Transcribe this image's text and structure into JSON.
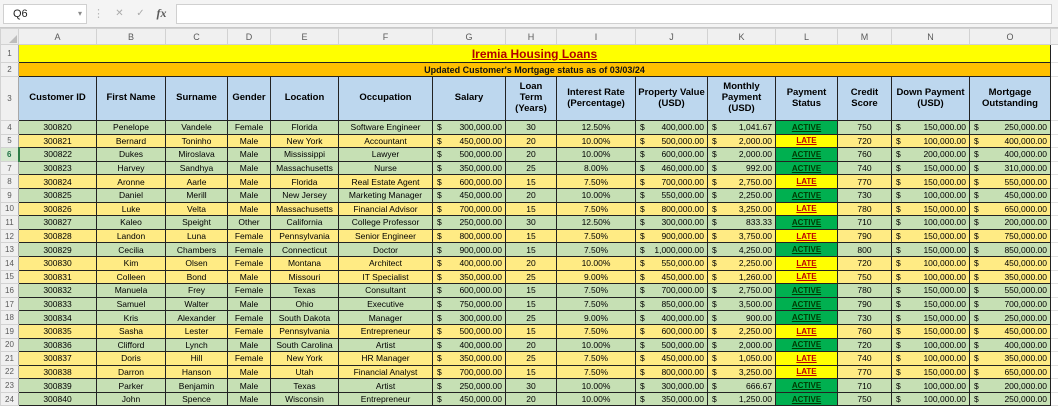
{
  "formula_bar": {
    "name_box_value": "Q6",
    "cancel_label": "✕",
    "confirm_label": "✓",
    "insert_function_label": "fx",
    "formula_value": ""
  },
  "sheet": {
    "column_letters": [
      "A",
      "B",
      "C",
      "D",
      "E",
      "F",
      "G",
      "H",
      "I",
      "J",
      "K",
      "L",
      "M",
      "N",
      "O"
    ],
    "row_numbers": [
      "1",
      "2",
      "3",
      "4",
      "5",
      "6",
      "7",
      "8",
      "9",
      "10",
      "11",
      "12",
      "13",
      "14",
      "15",
      "16",
      "17",
      "18",
      "19",
      "20",
      "21",
      "22",
      "23",
      "24"
    ],
    "first_data_row": 4,
    "active_row": 6,
    "title": "Iremia Housing Loans",
    "subtitle": "Updated Customer's Mortgage status as of 03/03/24"
  },
  "colors": {
    "title_bg": "#ffff00",
    "title_text": "#b30000",
    "subtitle_bg": "#ffc000",
    "header_bg": "#bdd7ee",
    "active_row_bg": "#c6e0b4",
    "late_row_bg": "#ffeb84",
    "status_active_bg": "#00b050",
    "status_late_bg": "#ffff00",
    "status_late_text": "#c00000"
  },
  "table": {
    "currency_symbol": "$",
    "headers": [
      "Customer ID",
      "First Name",
      "Surname",
      "Gender",
      "Location",
      "Occupation",
      "Salary",
      "Loan Term (Years)",
      "Interest Rate (Percentage)",
      "Property Value (USD)",
      "Monthly Payment (USD)",
      "Payment Status",
      "Credit Score",
      "Down Payment (USD)",
      "Mortgage Outstanding"
    ],
    "rows": [
      {
        "customer_id": "300820",
        "first_name": "Penelope",
        "surname": "Vandele",
        "gender": "Female",
        "location": "Florida",
        "occupation": "Software Engineer",
        "salary": "300,000.00",
        "loan_term": "30",
        "interest_rate": "12.50%",
        "property_value": "400,000.00",
        "monthly_payment": "1,041.67",
        "payment_status": "ACTIVE",
        "credit_score": "750",
        "down_payment": "150,000.00",
        "mortgage_outstanding": "250,000.00"
      },
      {
        "customer_id": "300821",
        "first_name": "Bernard",
        "surname": "Toninho",
        "gender": "Male",
        "location": "New York",
        "occupation": "Accountant",
        "salary": "450,000.00",
        "loan_term": "20",
        "interest_rate": "10.00%",
        "property_value": "500,000.00",
        "monthly_payment": "2,000.00",
        "payment_status": "LATE",
        "credit_score": "720",
        "down_payment": "100,000.00",
        "mortgage_outstanding": "400,000.00"
      },
      {
        "customer_id": "300822",
        "first_name": "Dukes",
        "surname": "Miroslava",
        "gender": "Male",
        "location": "Mississippi",
        "occupation": "Lawyer",
        "salary": "500,000.00",
        "loan_term": "20",
        "interest_rate": "10.00%",
        "property_value": "600,000.00",
        "monthly_payment": "2,000.00",
        "payment_status": "ACTIVE",
        "credit_score": "760",
        "down_payment": "200,000.00",
        "mortgage_outstanding": "400,000.00"
      },
      {
        "customer_id": "300823",
        "first_name": "Harvey",
        "surname": "Sandhya",
        "gender": "Male",
        "location": "Massachusetts",
        "occupation": "Nurse",
        "salary": "350,000.00",
        "loan_term": "25",
        "interest_rate": "8.00%",
        "property_value": "460,000.00",
        "monthly_payment": "992.00",
        "payment_status": "ACTIVE",
        "credit_score": "740",
        "down_payment": "150,000.00",
        "mortgage_outstanding": "310,000.00"
      },
      {
        "customer_id": "300824",
        "first_name": "Aronne",
        "surname": "Aarle",
        "gender": "Male",
        "location": "Florida",
        "occupation": "Real Estate Agent",
        "salary": "600,000.00",
        "loan_term": "15",
        "interest_rate": "7.50%",
        "property_value": "700,000.00",
        "monthly_payment": "2,750.00",
        "payment_status": "LATE",
        "credit_score": "770",
        "down_payment": "150,000.00",
        "mortgage_outstanding": "550,000.00"
      },
      {
        "customer_id": "300825",
        "first_name": "Daniel",
        "surname": "Merill",
        "gender": "Male",
        "location": "New Jersey",
        "occupation": "Marketing Manager",
        "salary": "450,000.00",
        "loan_term": "20",
        "interest_rate": "10.00%",
        "property_value": "550,000.00",
        "monthly_payment": "2,250.00",
        "payment_status": "ACTIVE",
        "credit_score": "730",
        "down_payment": "100,000.00",
        "mortgage_outstanding": "450,000.00"
      },
      {
        "customer_id": "300826",
        "first_name": "Luke",
        "surname": "Velta",
        "gender": "Male",
        "location": "Massachusetts",
        "occupation": "Financial Advisor",
        "salary": "700,000.00",
        "loan_term": "15",
        "interest_rate": "7.50%",
        "property_value": "800,000.00",
        "monthly_payment": "3,250.00",
        "payment_status": "LATE",
        "credit_score": "780",
        "down_payment": "150,000.00",
        "mortgage_outstanding": "650,000.00"
      },
      {
        "customer_id": "300827",
        "first_name": "Kaleo",
        "surname": "Speight",
        "gender": "Other",
        "location": "California",
        "occupation": "College Professor",
        "salary": "250,000.00",
        "loan_term": "30",
        "interest_rate": "12.50%",
        "property_value": "300,000.00",
        "monthly_payment": "833.33",
        "payment_status": "ACTIVE",
        "credit_score": "710",
        "down_payment": "100,000.00",
        "mortgage_outstanding": "200,000.00"
      },
      {
        "customer_id": "300828",
        "first_name": "Landon",
        "surname": "Luna",
        "gender": "Female",
        "location": "Pennsylvania",
        "occupation": "Senior Engineer",
        "salary": "800,000.00",
        "loan_term": "15",
        "interest_rate": "7.50%",
        "property_value": "900,000.00",
        "monthly_payment": "3,750.00",
        "payment_status": "LATE",
        "credit_score": "790",
        "down_payment": "150,000.00",
        "mortgage_outstanding": "750,000.00"
      },
      {
        "customer_id": "300829",
        "first_name": "Cecilia",
        "surname": "Chambers",
        "gender": "Female",
        "location": "Connecticut",
        "occupation": "Doctor",
        "salary": "900,000.00",
        "loan_term": "15",
        "interest_rate": "7.50%",
        "property_value": "1,000,000.00",
        "monthly_payment": "4,250.00",
        "payment_status": "ACTIVE",
        "credit_score": "800",
        "down_payment": "150,000.00",
        "mortgage_outstanding": "850,000.00"
      },
      {
        "customer_id": "300830",
        "first_name": "Kim",
        "surname": "Olsen",
        "gender": "Female",
        "location": "Montana",
        "occupation": "Architect",
        "salary": "400,000.00",
        "loan_term": "20",
        "interest_rate": "10.00%",
        "property_value": "550,000.00",
        "monthly_payment": "2,250.00",
        "payment_status": "LATE",
        "credit_score": "720",
        "down_payment": "100,000.00",
        "mortgage_outstanding": "450,000.00"
      },
      {
        "customer_id": "300831",
        "first_name": "Colleen",
        "surname": "Bond",
        "gender": "Male",
        "location": "Missouri",
        "occupation": "IT Specialist",
        "salary": "350,000.00",
        "loan_term": "25",
        "interest_rate": "9.00%",
        "property_value": "450,000.00",
        "monthly_payment": "1,260.00",
        "payment_status": "LATE",
        "credit_score": "750",
        "down_payment": "100,000.00",
        "mortgage_outstanding": "350,000.00"
      },
      {
        "customer_id": "300832",
        "first_name": "Manuela",
        "surname": "Frey",
        "gender": "Female",
        "location": "Texas",
        "occupation": "Consultant",
        "salary": "600,000.00",
        "loan_term": "15",
        "interest_rate": "7.50%",
        "property_value": "700,000.00",
        "monthly_payment": "2,750.00",
        "payment_status": "ACTIVE",
        "credit_score": "780",
        "down_payment": "150,000.00",
        "mortgage_outstanding": "550,000.00"
      },
      {
        "customer_id": "300833",
        "first_name": "Samuel",
        "surname": "Walter",
        "gender": "Male",
        "location": "Ohio",
        "occupation": "Executive",
        "salary": "750,000.00",
        "loan_term": "15",
        "interest_rate": "7.50%",
        "property_value": "850,000.00",
        "monthly_payment": "3,500.00",
        "payment_status": "ACTIVE",
        "credit_score": "790",
        "down_payment": "150,000.00",
        "mortgage_outstanding": "700,000.00"
      },
      {
        "customer_id": "300834",
        "first_name": "Kris",
        "surname": "Alexander",
        "gender": "Female",
        "location": "South Dakota",
        "occupation": "Manager",
        "salary": "300,000.00",
        "loan_term": "25",
        "interest_rate": "9.00%",
        "property_value": "400,000.00",
        "monthly_payment": "900.00",
        "payment_status": "ACTIVE",
        "credit_score": "730",
        "down_payment": "150,000.00",
        "mortgage_outstanding": "250,000.00"
      },
      {
        "customer_id": "300835",
        "first_name": "Sasha",
        "surname": "Lester",
        "gender": "Female",
        "location": "Pennsylvania",
        "occupation": "Entrepreneur",
        "salary": "500,000.00",
        "loan_term": "15",
        "interest_rate": "7.50%",
        "property_value": "600,000.00",
        "monthly_payment": "2,250.00",
        "payment_status": "LATE",
        "credit_score": "760",
        "down_payment": "150,000.00",
        "mortgage_outstanding": "450,000.00"
      },
      {
        "customer_id": "300836",
        "first_name": "Clifford",
        "surname": "Lynch",
        "gender": "Male",
        "location": "South Carolina",
        "occupation": "Artist",
        "salary": "400,000.00",
        "loan_term": "20",
        "interest_rate": "10.00%",
        "property_value": "500,000.00",
        "monthly_payment": "2,000.00",
        "payment_status": "ACTIVE",
        "credit_score": "720",
        "down_payment": "100,000.00",
        "mortgage_outstanding": "400,000.00"
      },
      {
        "customer_id": "300837",
        "first_name": "Doris",
        "surname": "Hill",
        "gender": "Female",
        "location": "New York",
        "occupation": "HR Manager",
        "salary": "350,000.00",
        "loan_term": "25",
        "interest_rate": "7.50%",
        "property_value": "450,000.00",
        "monthly_payment": "1,050.00",
        "payment_status": "LATE",
        "credit_score": "740",
        "down_payment": "100,000.00",
        "mortgage_outstanding": "350,000.00"
      },
      {
        "customer_id": "300838",
        "first_name": "Darron",
        "surname": "Hanson",
        "gender": "Male",
        "location": "Utah",
        "occupation": "Financial Analyst",
        "salary": "700,000.00",
        "loan_term": "15",
        "interest_rate": "7.50%",
        "property_value": "800,000.00",
        "monthly_payment": "3,250.00",
        "payment_status": "LATE",
        "credit_score": "770",
        "down_payment": "150,000.00",
        "mortgage_outstanding": "650,000.00"
      },
      {
        "customer_id": "300839",
        "first_name": "Parker",
        "surname": "Benjamin",
        "gender": "Male",
        "location": "Texas",
        "occupation": "Artist",
        "salary": "250,000.00",
        "loan_term": "30",
        "interest_rate": "10.00%",
        "property_value": "300,000.00",
        "monthly_payment": "666.67",
        "payment_status": "ACTIVE",
        "credit_score": "710",
        "down_payment": "100,000.00",
        "mortgage_outstanding": "200,000.00"
      },
      {
        "customer_id": "300840",
        "first_name": "John",
        "surname": "Spence",
        "gender": "Male",
        "location": "Wisconsin",
        "occupation": "Entrepreneur",
        "salary": "450,000.00",
        "loan_term": "20",
        "interest_rate": "10.00%",
        "property_value": "350,000.00",
        "monthly_payment": "1,250.00",
        "payment_status": "ACTIVE",
        "credit_score": "750",
        "down_payment": "100,000.00",
        "mortgage_outstanding": "250,000.00"
      }
    ]
  }
}
